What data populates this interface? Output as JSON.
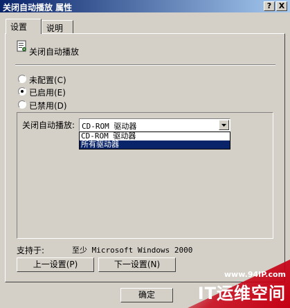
{
  "window": {
    "title": "关闭自动播放 属性",
    "help_btn": "?",
    "close_btn": "X"
  },
  "tabs": [
    {
      "label": "设置",
      "active": true
    },
    {
      "label": "说明",
      "active": false
    }
  ],
  "policy": {
    "icon": "policy-setting-icon",
    "name": "关闭自动播放"
  },
  "options": [
    {
      "label": "未配置(C)",
      "selected": false
    },
    {
      "label": "已启用(E)",
      "selected": true
    },
    {
      "label": "已禁用(D)",
      "selected": false
    }
  ],
  "setting": {
    "label": "关闭自动播放:",
    "value": "CD-ROM 驱动器",
    "dropdown_options": [
      "CD-ROM 驱动器",
      "所有驱动器"
    ],
    "highlighted_index": 1
  },
  "support": {
    "label": "支持于:",
    "value": "至少 Microsoft Windows 2000"
  },
  "buttons": {
    "prev": "上一设置(P)",
    "next": "下一设置(N)",
    "ok": "确定"
  },
  "watermark": {
    "url": "www.94IP.com",
    "brand": "IT运维空间"
  },
  "colors": {
    "face": "#d4d0c8",
    "title_start": "#0a246a",
    "title_end": "#a6caf0",
    "selection": "#0a246a",
    "watermark": "#c40013"
  }
}
